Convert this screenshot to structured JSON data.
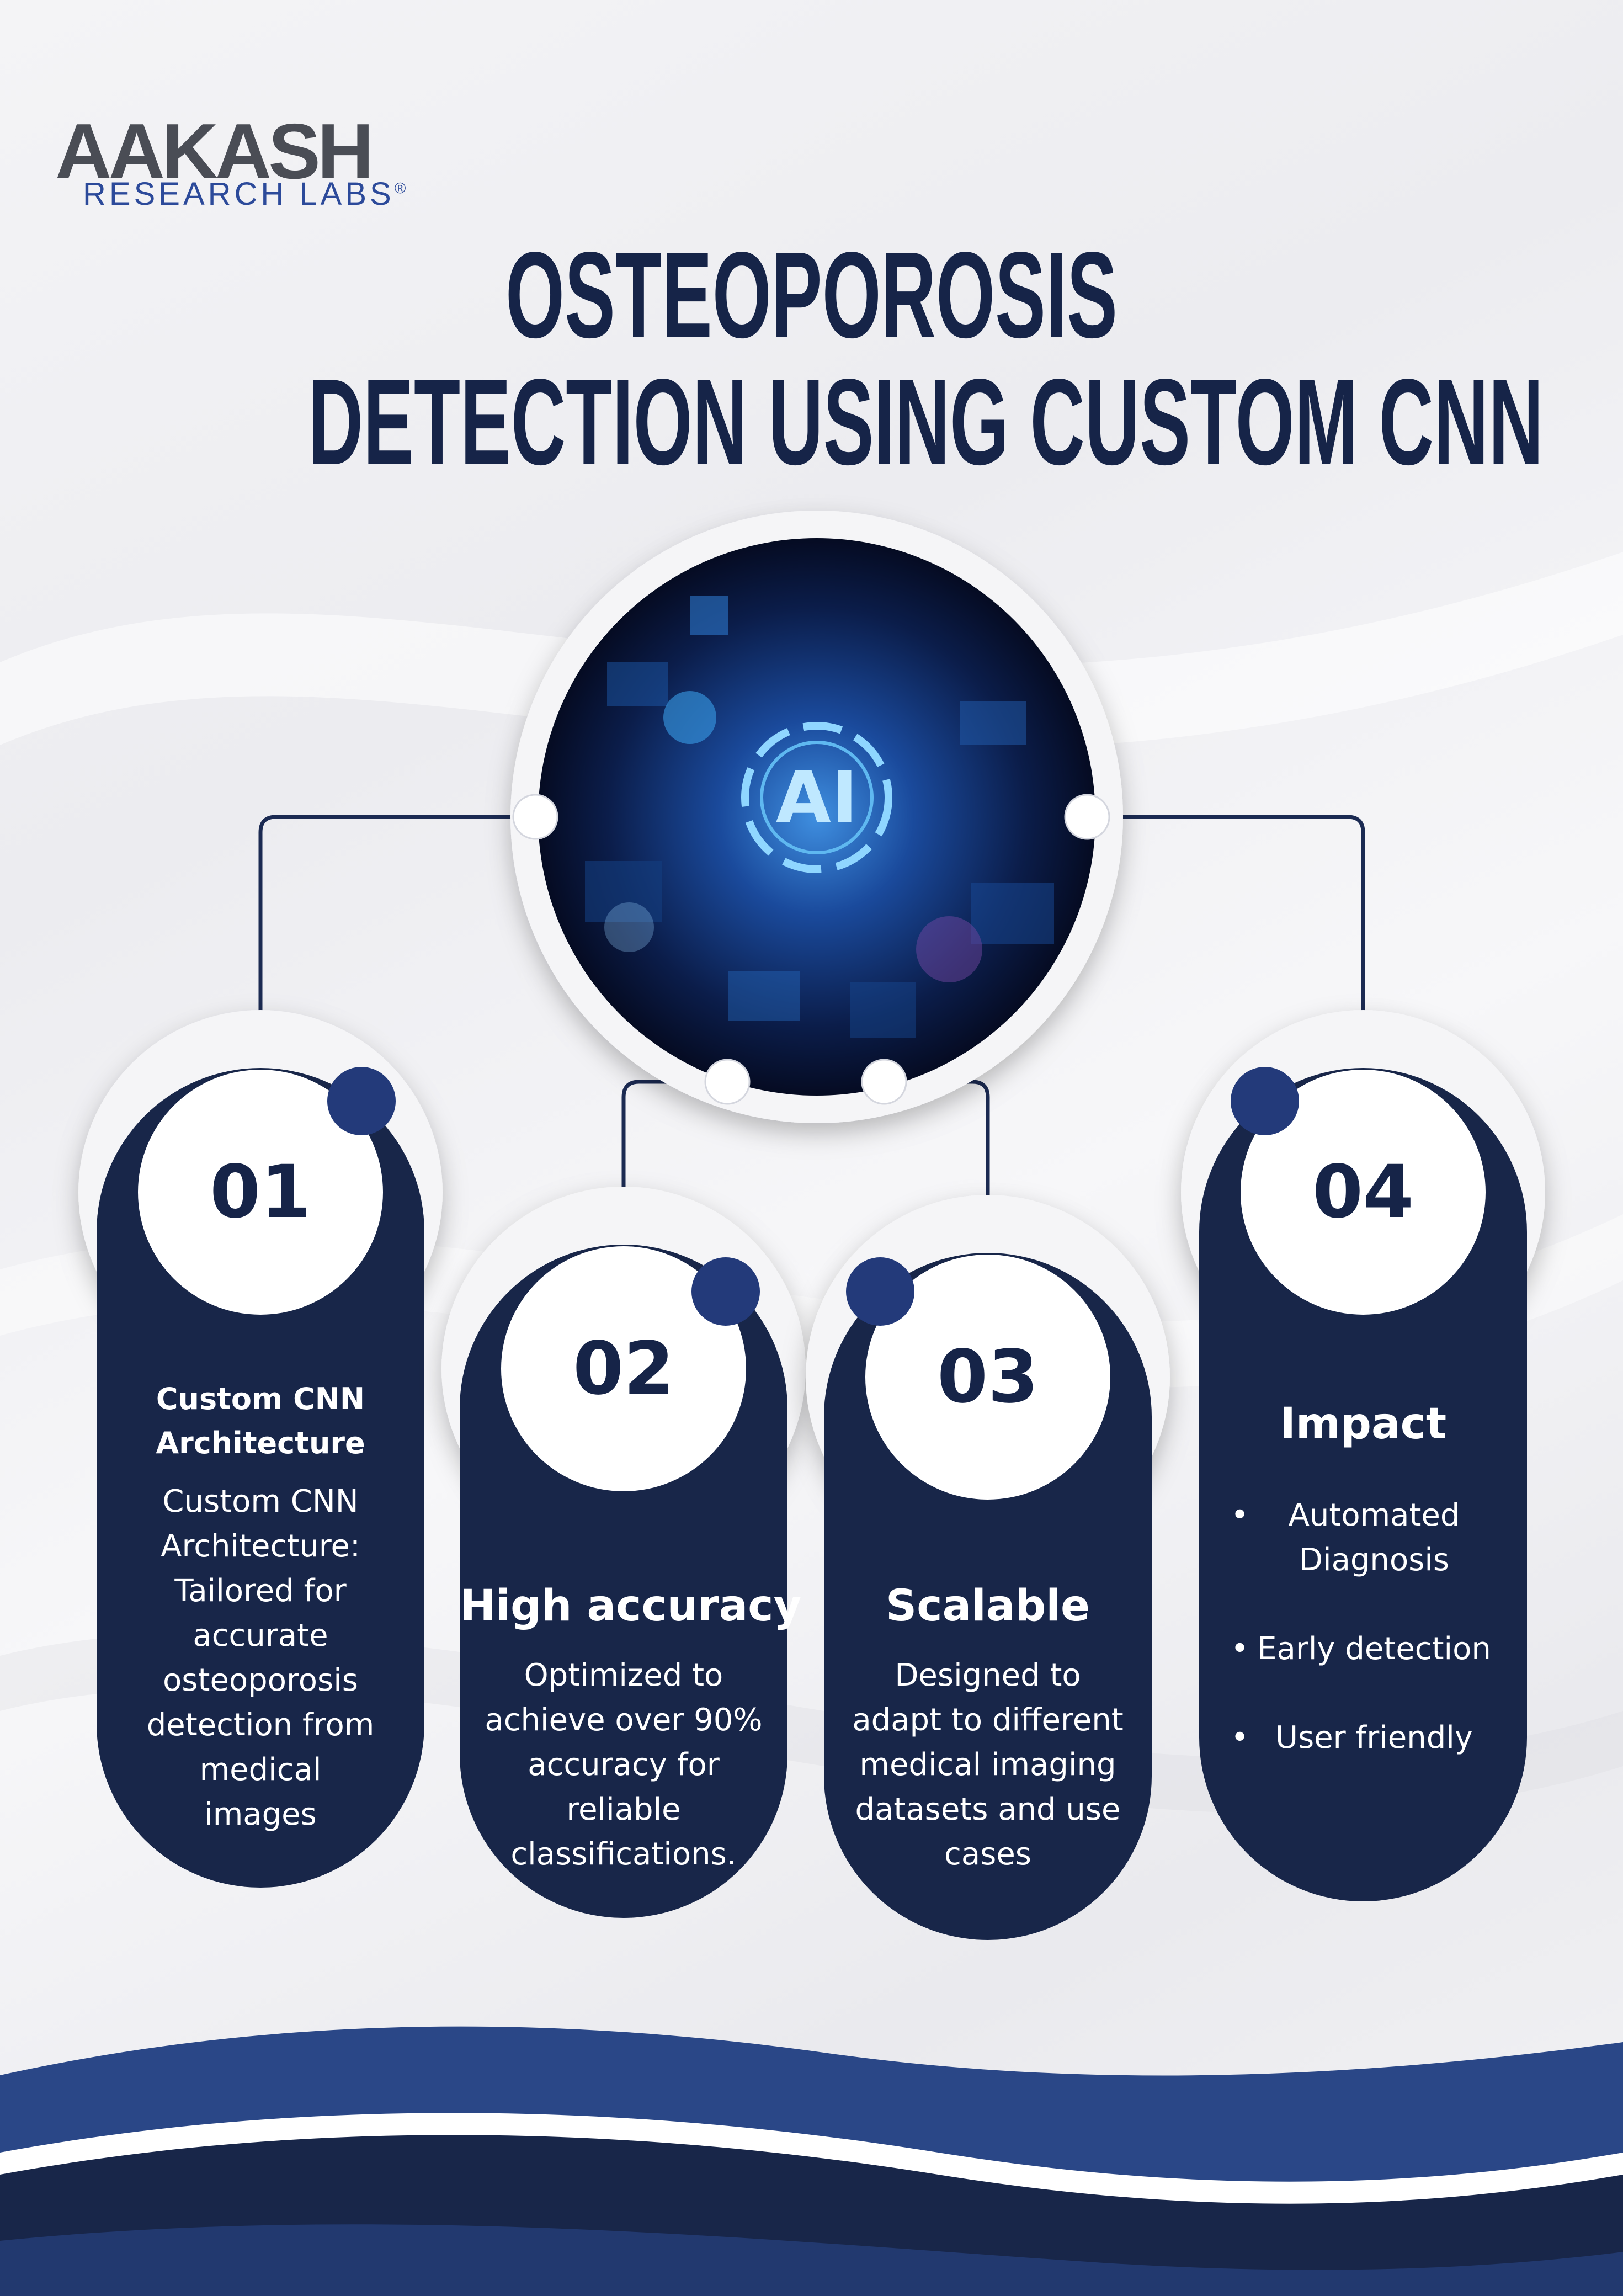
{
  "brand": {
    "name": "AAKASH",
    "subtitle": "RESEARCH LABS",
    "registered": "®",
    "accent_color": "#2c4a9a",
    "dark_color": "#4a4d55"
  },
  "title": {
    "line1": "OSTEOPOROSIS",
    "line2": "DETECTION USING CUSTOM CNN"
  },
  "hero": {
    "center_text": "AI"
  },
  "steps": [
    {
      "number": "01",
      "title_line1": "Custom CNN",
      "title_line2": "Architecture",
      "text_lines": [
        "Custom CNN",
        "Architecture:",
        "Tailored for",
        "accurate",
        "osteoporosis",
        "detection from",
        "medical",
        "images"
      ]
    },
    {
      "number": "02",
      "title": "High accuracy",
      "text_lines": [
        "Optimized to",
        "achieve over 90%",
        "accuracy for",
        "reliable",
        "classifications."
      ]
    },
    {
      "number": "03",
      "title": "Scalable",
      "text_lines": [
        "Designed to",
        "adapt to different",
        "medical imaging",
        "datasets and use",
        "cases"
      ]
    },
    {
      "number": "04",
      "title": "Impact",
      "bullets": [
        {
          "line1": "Automated",
          "line2": "Diagnosis"
        },
        {
          "line1": "Early detection",
          "line2": ""
        },
        {
          "line1": "User friendly",
          "line2": ""
        }
      ]
    }
  ],
  "colors": {
    "navy": "#162448",
    "dot_blue": "#233a7a",
    "wave_blue": "#25407f"
  }
}
